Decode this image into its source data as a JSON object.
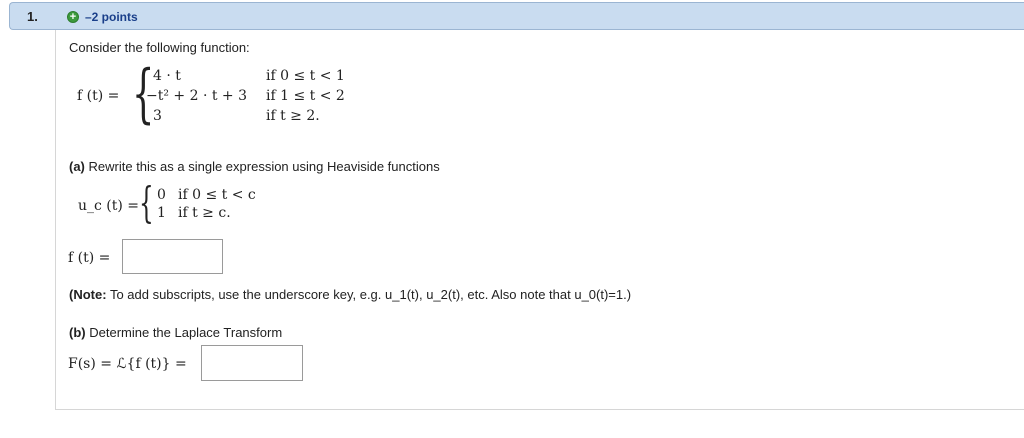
{
  "question": {
    "number": "1.",
    "points": "–2 points"
  },
  "intro": "Consider the following function:",
  "function_def": {
    "lhs": "f (t) =",
    "cases": [
      {
        "expr": "4 · t",
        "cond": "if 0 ≤ t < 1"
      },
      {
        "expr": "−t² + 2 · t + 3",
        "cond": "if 1 ≤ t < 2"
      },
      {
        "expr": "3",
        "cond": "if t ≥ 2."
      }
    ]
  },
  "part_a": {
    "label": "(a)",
    "text": "Rewrite this as a single expression using Heaviside functions",
    "heaviside_lhs": "u_c (t) =",
    "heaviside_cases": [
      {
        "expr": "0",
        "cond": "if 0 ≤ t < c"
      },
      {
        "expr": "1",
        "cond": "if t ≥ c."
      }
    ],
    "answer_lhs": "f (t) =",
    "note_label": "(Note:",
    "note_text": "To add subscripts, use the underscore key, e.g. u_1(t), u_2(t), etc. Also note that u_0(t)=1.)"
  },
  "part_b": {
    "label": "(b)",
    "text": "Determine the Laplace Transform",
    "answer_lhs": "F(s) = ℒ{f (t)} ="
  }
}
